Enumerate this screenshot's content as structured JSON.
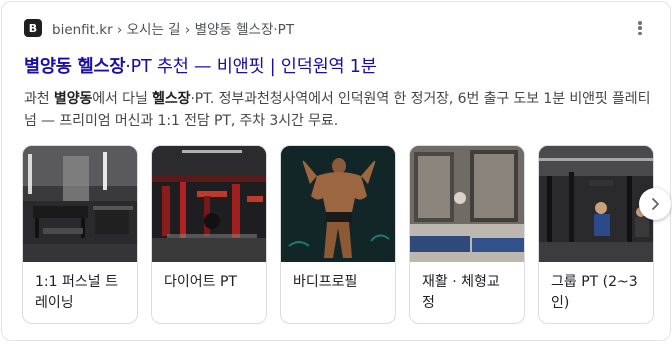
{
  "result": {
    "favicon_letter": "B",
    "source": "bienfit.kr › 오시는 길 › 별양동 헬스장·PT",
    "title_bold": "별양동 헬스장",
    "title_rest": "·PT 추천 — 비앤핏 | 인덕원역 1분",
    "snippet": {
      "p1": "과천 ",
      "b1": "별양동",
      "p2": "에서 다닐 ",
      "b2": "헬스장",
      "p3": "·PT. 정부과천청사역에서 인덕원역 한 정거장, 6번 출구 도보 1분 비앤핏 플레티넘 — 프리미엄 머신과 1:1 전담 PT, 주차 3시간 무료."
    }
  },
  "carousel": {
    "tiles": [
      {
        "label": "1:1 퍼스널 트레이닝",
        "image": "gym-floor-photo"
      },
      {
        "label": "다이어트 PT",
        "image": "red-machines-photo"
      },
      {
        "label": "바디프로필",
        "image": "bodybuilder-photo"
      },
      {
        "label": "재활 · 체형교정",
        "image": "mirror-studio-photo"
      },
      {
        "label": "그룹 PT (2~3인)",
        "image": "gym-members-photo"
      }
    ],
    "next_icon": "chevron-right-icon"
  },
  "colors": {
    "link": "#1a0dab",
    "source": "#4d5156",
    "snippet": "#474747"
  }
}
